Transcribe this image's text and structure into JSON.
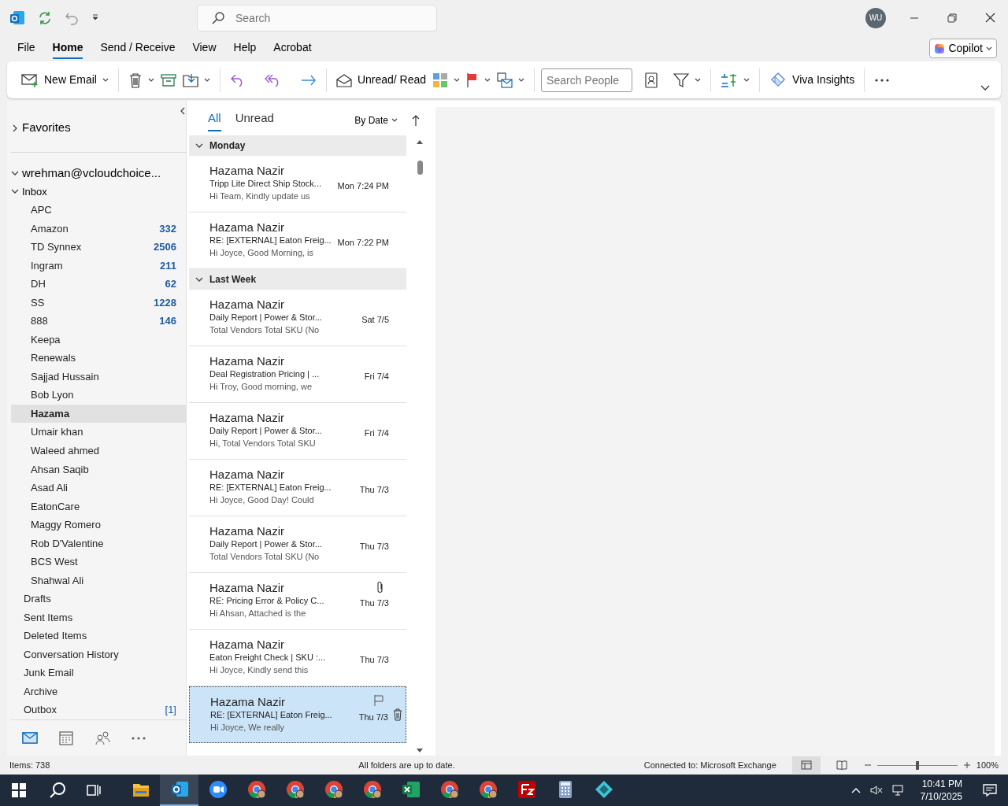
{
  "title_bar": {
    "search": {
      "placeholder": "Search"
    },
    "avatar": "WU"
  },
  "menu_tabs": [
    {
      "label": "File",
      "selected": false
    },
    {
      "label": "Home",
      "selected": true
    },
    {
      "label": "Send / Receive",
      "selected": false
    },
    {
      "label": "View",
      "selected": false
    },
    {
      "label": "Help",
      "selected": false
    },
    {
      "label": "Acrobat",
      "selected": false
    }
  ],
  "copilot": "Copilot",
  "ribbon": {
    "new_email": "New Email",
    "unread_read": "Unread/ Read",
    "search_people": {
      "placeholder": "Search People"
    },
    "viva_insights": "Viva Insights"
  },
  "folder_pane": {
    "favorites": {
      "label": "Favorites",
      "expanded": false
    },
    "account": {
      "label": "wrehman@vcloudchoice...",
      "expanded": true
    },
    "inbox": {
      "label": "Inbox",
      "expanded": true,
      "children": [
        {
          "name": "APC",
          "selected": false
        },
        {
          "name": "Amazon",
          "count": "332",
          "selected": false
        },
        {
          "name": "TD Synnex",
          "count": "2506",
          "selected": false
        },
        {
          "name": "Ingram",
          "count": "211",
          "selected": false
        },
        {
          "name": "DH",
          "count": "62",
          "selected": false
        },
        {
          "name": "SS",
          "count": "1228",
          "selected": false
        },
        {
          "name": "888",
          "count": "146",
          "selected": false
        },
        {
          "name": "Keepa",
          "selected": false
        },
        {
          "name": "Renewals",
          "selected": false
        },
        {
          "name": "Sajjad Hussain",
          "selected": false
        },
        {
          "name": "Bob Lyon",
          "selected": false
        },
        {
          "name": "Hazama",
          "selected": true
        },
        {
          "name": "Umair khan",
          "selected": false
        },
        {
          "name": "Waleed ahmed",
          "selected": false
        },
        {
          "name": "Ahsan Saqib",
          "selected": false
        },
        {
          "name": "Asad Ali",
          "selected": false
        },
        {
          "name": "EatonCare",
          "selected": false
        },
        {
          "name": "Maggy Romero",
          "selected": false
        },
        {
          "name": "Rob D'Valentine",
          "selected": false
        },
        {
          "name": "BCS West",
          "selected": false
        },
        {
          "name": "Shahwal Ali",
          "selected": false
        }
      ]
    },
    "folders": [
      {
        "name": "Drafts"
      },
      {
        "name": "Sent Items"
      },
      {
        "name": "Deleted Items"
      },
      {
        "name": "Conversation History"
      },
      {
        "name": "Junk Email"
      },
      {
        "name": "Archive"
      },
      {
        "name": "Outbox",
        "count": "[1]"
      }
    ],
    "nav": [
      {
        "kind": "mail",
        "selected": true
      },
      {
        "kind": "calendar",
        "selected": false
      },
      {
        "kind": "people",
        "selected": false
      },
      {
        "kind": "more",
        "selected": false
      }
    ]
  },
  "message_list": {
    "filters": [
      {
        "label": "All",
        "selected": true
      },
      {
        "label": "Unread",
        "selected": false
      }
    ],
    "sort": "By Date",
    "groups": [
      {
        "label": "Monday",
        "expanded": true,
        "messages": [
          {
            "sender": "Hazama Nazir",
            "subject": "Tripp Lite Direct Ship Stock...",
            "preview": "Hi Team,  Kindly update us",
            "time": "Mon 7:24 PM",
            "attachment": false,
            "selected": false
          },
          {
            "sender": "Hazama Nazir",
            "subject": "RE: [EXTERNAL] Eaton Freig...",
            "preview": "Hi Joyce,  Good Morning, is",
            "time": "Mon 7:22 PM",
            "attachment": false,
            "selected": false
          }
        ]
      },
      {
        "label": "Last Week",
        "expanded": true,
        "messages": [
          {
            "sender": "Hazama Nazir",
            "subject": "Daily Report | Power & Stor...",
            "preview": "Total Vendors  Total SKU (No",
            "time": "Sat 7/5",
            "attachment": false,
            "selected": false
          },
          {
            "sender": "Hazama Nazir",
            "subject": "Deal Registration Pricing | ...",
            "preview": "Hi Troy,  Good morning, we",
            "time": "Fri 7/4",
            "attachment": false,
            "selected": false
          },
          {
            "sender": "Hazama Nazir",
            "subject": "Daily Report | Power & Stor...",
            "preview": "Hi,  Total Vendors  Total SKU",
            "time": "Fri 7/4",
            "attachment": false,
            "selected": false
          },
          {
            "sender": "Hazama Nazir",
            "subject": "RE: [EXTERNAL] Eaton Freig...",
            "preview": "Hi Joyce,  Good Day! Could",
            "time": "Thu 7/3",
            "attachment": false,
            "selected": false
          },
          {
            "sender": "Hazama Nazir",
            "subject": "Daily Report | Power & Stor...",
            "preview": "Total Vendors  Total SKU (No",
            "time": "Thu 7/3",
            "attachment": false,
            "selected": false
          },
          {
            "sender": "Hazama Nazir",
            "subject": "RE: Pricing Error & Policy C...",
            "preview": "Hi Ahsan,  Attached is the",
            "time": "Thu 7/3",
            "attachment": true,
            "selected": false
          },
          {
            "sender": "Hazama Nazir",
            "subject": "Eaton Freight Check | SKU :...",
            "preview": "Hi Joyce,  Kindly send this",
            "time": "Thu 7/3",
            "attachment": false,
            "selected": false
          },
          {
            "sender": "Hazama Nazir",
            "subject": "RE: [EXTERNAL] Eaton Freig...",
            "preview": "Hi Joyce,  We really",
            "time": "Thu 7/3",
            "attachment": false,
            "selected": true
          }
        ]
      }
    ]
  },
  "status_bar": {
    "items": "Items: 738",
    "sync": "All folders are up to date.",
    "connection": "Connected to: Microsoft Exchange",
    "zoom": {
      "level": 0.5,
      "reading": "100%"
    }
  },
  "taskbar": {
    "apps": [
      {
        "kind": "explorer",
        "selected": false
      },
      {
        "kind": "outlook",
        "selected": true
      },
      {
        "kind": "zoom",
        "selected": false
      },
      {
        "kind": "chrome",
        "selected": false
      },
      {
        "kind": "chrome",
        "selected": false
      },
      {
        "kind": "chrome",
        "selected": false
      },
      {
        "kind": "chrome",
        "selected": false
      },
      {
        "kind": "excel",
        "selected": false
      },
      {
        "kind": "chrome",
        "selected": false
      },
      {
        "kind": "chrome",
        "selected": false
      },
      {
        "kind": "filezilla",
        "selected": false
      },
      {
        "kind": "calculator",
        "selected": false
      },
      {
        "kind": "diamond",
        "selected": false
      }
    ],
    "time": "10:41 PM",
    "date": "7/10/2025"
  }
}
